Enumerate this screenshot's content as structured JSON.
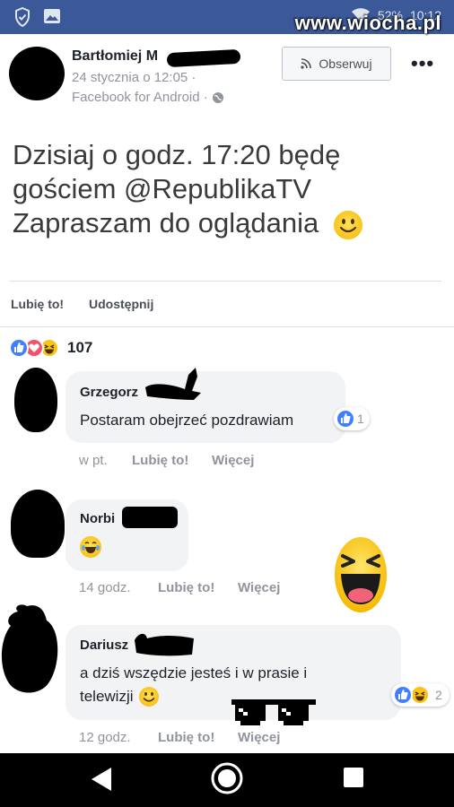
{
  "status_bar": {
    "battery": "52%",
    "time": "10:12",
    "watermark": "www.wiocha.pl"
  },
  "post": {
    "author_name": "Bartłomiej M",
    "date": "24 stycznia o 12:05 ·",
    "source": "Facebook for Android ·",
    "follow_label": "Obserwuj",
    "more_label": "•••",
    "text_lines": [
      "Dzisiaj o godz. 17:20 będę",
      "gościem @RepublikaTV",
      "Zapraszam do oglądania"
    ],
    "like_label": "Lubię to!",
    "share_label": "Udostępnij",
    "reaction_count": "107"
  },
  "comments": [
    {
      "author": "Grzegorz",
      "text": "Postaram obejrzeć pozdrawiam",
      "reaction_count": "1",
      "time": "w pt.",
      "like_label": "Lubię to!",
      "more_label": "Więcej"
    },
    {
      "author": "Norbi",
      "text": "",
      "time": "14 godz.",
      "like_label": "Lubię to!",
      "more_label": "Więcej"
    },
    {
      "author": "Dariusz",
      "text_lines": [
        "a dziś wszędzie jesteś i w prasie i",
        "telewizji"
      ],
      "reaction_count": "2",
      "time": "12 godz.",
      "like_label": "Lubię to!",
      "more_label": "Więcej"
    }
  ],
  "colors": {
    "facebook_blue": "#3b5998",
    "like_blue": "#4080ff",
    "love_red": "#f25268",
    "emoji_yellow": "#f9c218"
  }
}
